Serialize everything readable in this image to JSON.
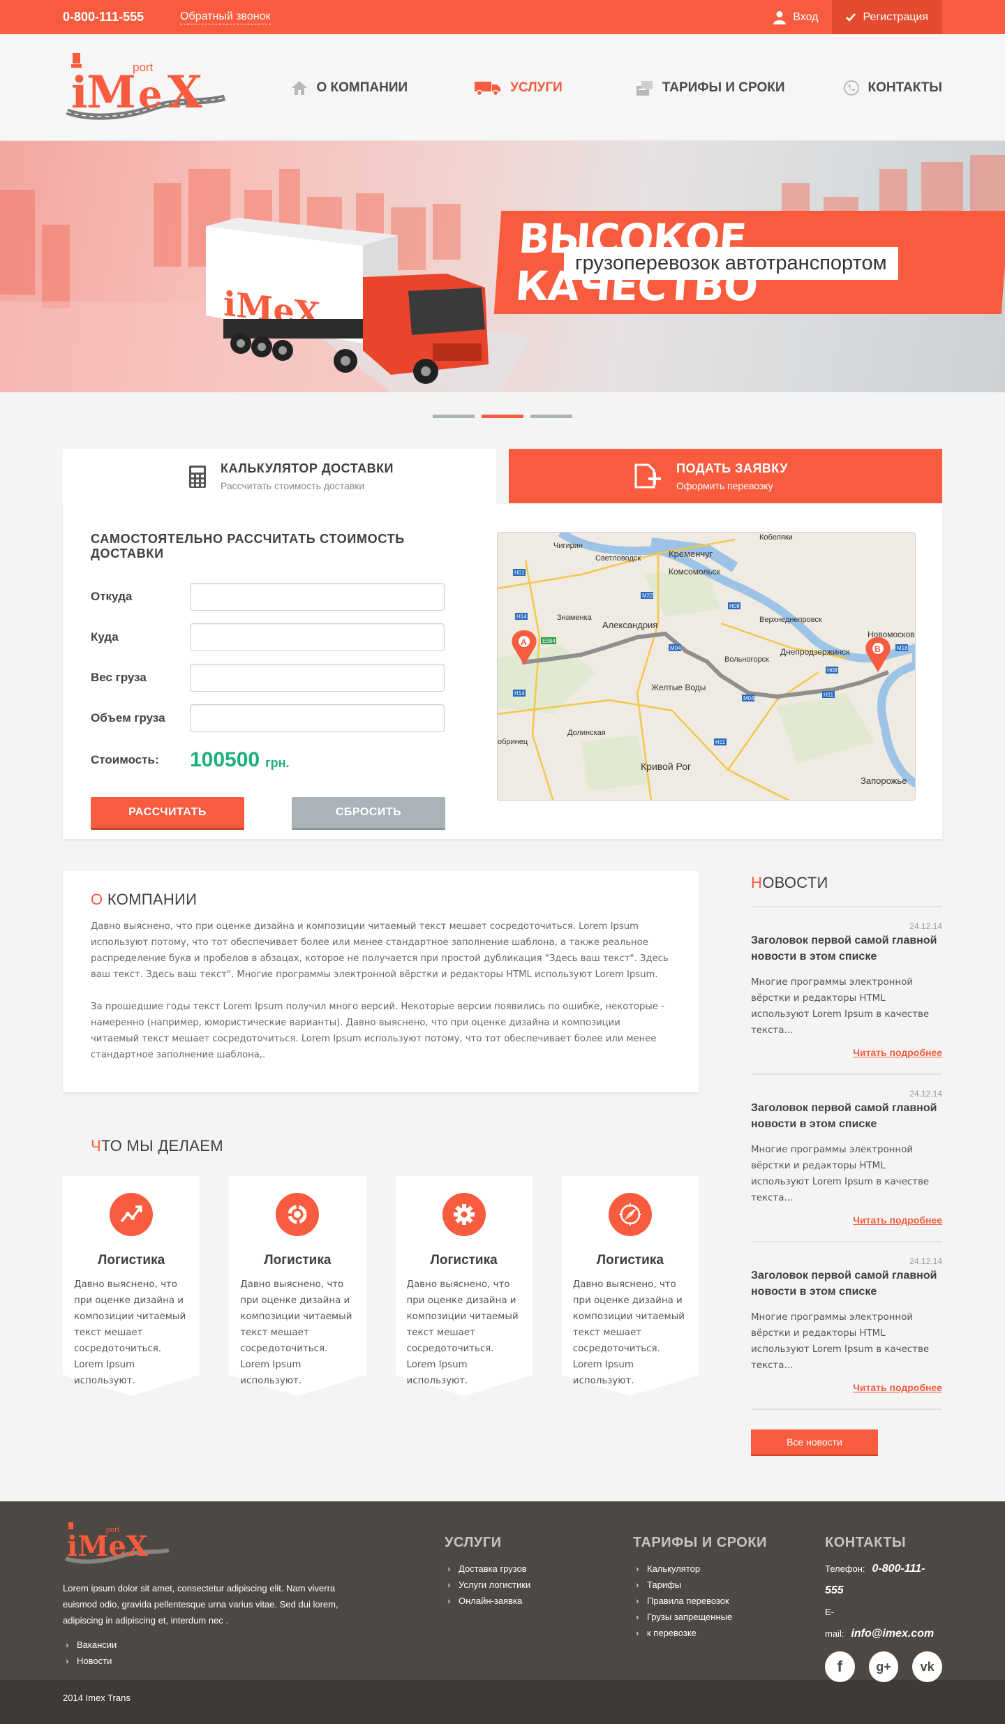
{
  "topbar": {
    "phone": "0-800-111-555",
    "callback": "Обратный звонок",
    "login": "Вход",
    "register": "Регистрация"
  },
  "logo": {
    "word": "iMeX",
    "small": "port"
  },
  "nav": [
    {
      "label": "О КОМПАНИИ",
      "icon": "home-icon"
    },
    {
      "label": "УСЛУГИ",
      "icon": "truck-icon"
    },
    {
      "label": "ТАРИФЫ И СРОКИ",
      "icon": "tariff-icon"
    },
    {
      "label": "КОНТАКТЫ",
      "icon": "phone-icon"
    }
  ],
  "hero": {
    "title": "ВЫСОКОЕ КАЧЕСТВО",
    "subtitle": "грузоперевозок автотранспортом",
    "slides": 3,
    "active_slide": 2
  },
  "tabs": [
    {
      "title": "КАЛЬКУЛЯТОР ДОСТАВКИ",
      "sub": "Рассчитать стоимость доставки",
      "icon": "calculator-icon"
    },
    {
      "title": "ПОДАТЬ ЗАЯВКУ",
      "sub": "Оформить перевозку",
      "icon": "add-document-icon"
    }
  ],
  "calc": {
    "heading": "САМОСТОЯТЕЛЬНО РАССЧИТАТЬ СТОИМОСТЬ ДОСТАВКИ",
    "fields": [
      {
        "label": "Откуда",
        "value": ""
      },
      {
        "label": "Куда",
        "value": ""
      },
      {
        "label": "Вес груза",
        "value": ""
      },
      {
        "label": "Объем груза",
        "value": ""
      }
    ],
    "cost_label": "Стоимость:",
    "cost_value": "100500",
    "currency": "грн.",
    "calc_button": "РАССЧИТАТЬ",
    "reset_button": "СБРОСИТЬ"
  },
  "map": {
    "labels": [
      "Кобеляки",
      "Чигирин",
      "Светловодск",
      "Кременчуг",
      "Комсомольск",
      "Знаменка",
      "Александрия",
      "Верхнеднепровск",
      "Новомосковск",
      "Днепродзержинск",
      "Вольногорск",
      "Желтые Воды",
      "Долинская",
      "Кривой Рог",
      "Запорожье",
      "обринец"
    ],
    "roads": [
      "H01",
      "M22",
      "H08",
      "E584",
      "M04",
      "H14",
      "H08",
      "H11",
      "M04",
      "M18",
      "H11",
      "H14"
    ],
    "marker_a": "A",
    "marker_b": "B"
  },
  "about": {
    "title_first": "О",
    "title_rest": " КОМПАНИИ",
    "p1": "Давно выяснено, что при оценке дизайна и композиции читаемый текст мешает сосредоточиться. Lorem Ipsum используют потому, что тот обеспечивает более или менее стандартное заполнение шаблона, а также реальное распределение букв и пробелов в абзацах, которое не получается при простой дубликация \"Здесь ваш текст\". Здесь ваш текст. Здесь ваш текст\". Многие программы электронной вёрстки и редакторы HTML используют Lorem Ipsum.",
    "p2": "За прошедшие годы текст Lorem Ipsum получил много версий. Некоторые версии появились по ошибке, некоторые - намеренно (например, юмористические варианты). Давно выяснено, что при оценке дизайна и композиции читаемый текст мешает сосредоточиться. Lorem Ipsum используют потому, что тот обеспечивает более или менее стандартное заполнение шаблона,."
  },
  "what": {
    "title_first": "Ч",
    "title_rest": "ТО МЫ ДЕЛАЕМ",
    "items": [
      {
        "title": "Логистика",
        "text": "Давно выяснено, что при оценке дизайна и композиции читаемый текст мешает сосредоточиться. Lorem Ipsum используют.",
        "icon": "chart-up-icon"
      },
      {
        "title": "Логистика",
        "text": "Давно выяснено, что при оценке дизайна и композиции читаемый текст мешает сосредоточиться. Lorem Ipsum используют.",
        "icon": "refresh-icon"
      },
      {
        "title": "Логистика",
        "text": "Давно выяснено, что при оценке дизайна и композиции читаемый текст мешает сосредоточиться. Lorem Ipsum используют.",
        "icon": "gear-icon"
      },
      {
        "title": "Логистика",
        "text": "Давно выяснено, что при оценке дизайна и композиции читаемый текст мешает сосредоточиться. Lorem Ipsum используют.",
        "icon": "compass-icon"
      }
    ]
  },
  "news": {
    "title_first": "Н",
    "title_rest": "ОВОСТИ",
    "items": [
      {
        "date": "24.12.14",
        "title": "Заголовок первой самой главной новости в этом списке",
        "text": "Многие программы электронной вёрстки и редакторы HTML используют Lorem Ipsum в качестве текста...",
        "more": "Читать подробнее"
      },
      {
        "date": "24.12.14",
        "title": "Заголовок первой самой главной новости в этом списке",
        "text": "Многие программы электронной вёрстки и редакторы HTML используют Lorem Ipsum в качестве текста...",
        "more": "Читать подробнее"
      },
      {
        "date": "24.12.14",
        "title": "Заголовок первой самой главной новости в этом списке",
        "text": "Многие программы электронной вёрстки и редакторы HTML используют Lorem Ipsum в качестве текста...",
        "more": "Читать подробнее"
      }
    ],
    "all_button": "Все новости"
  },
  "footer": {
    "desc": "Lorem ipsum dolor sit amet, consectetur adipiscing elit. Nam viverra euismod odio, gravida pellentesque urna varius vitae. Sed dui lorem, adipiscing in adipiscing et, interdum nec .",
    "links1": [
      "Вакансии",
      "Новости"
    ],
    "services_title": "УСЛУГИ",
    "services": [
      "Доставка грузов",
      "Услуги логистики",
      "Онлайн-заявка"
    ],
    "tariffs_title": "ТАРИФЫ И СРОКИ",
    "tariffs": [
      "Калькулятор",
      "Тарифы",
      "Правила перевозок",
      "Грузы запрещенные",
      "к перевозке"
    ],
    "contacts_title": "КОНТАКТЫ",
    "phone_label": "Телефон:",
    "phone": "0-800-111-555",
    "email_label": "E-mail:",
    "email": "info@imex.com",
    "socials": [
      {
        "name": "facebook",
        "glyph": "f"
      },
      {
        "name": "google-plus",
        "glyph": "g+"
      },
      {
        "name": "vk",
        "glyph": "vk"
      }
    ],
    "copyright": "2014  Imex Trans"
  },
  "colors": {
    "accent": "#f85b3e",
    "accent_dark": "#e44a2e",
    "green": "#1bb07a",
    "footer": "#4d4843"
  }
}
